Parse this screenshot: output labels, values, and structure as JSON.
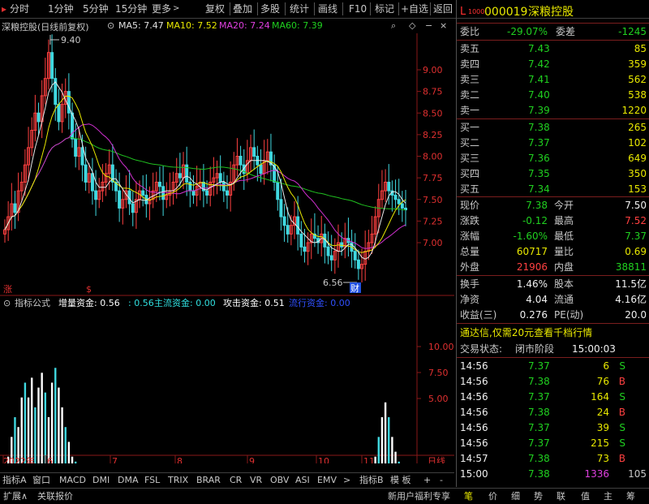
{
  "toolbar": {
    "items": [
      "分时",
      "1分钟",
      "5分钟",
      "15分钟",
      "更多",
      "复权",
      "叠加",
      "多股",
      "统计",
      "画线",
      "F10",
      "标记",
      "+自选",
      "返回"
    ]
  },
  "stock": {
    "code": "000019",
    "name": "深粮控股",
    "badge_main": "L",
    "badge_sub": "1000"
  },
  "main_chart": {
    "title": "深粮控股(日线前复权)",
    "ma": [
      {
        "label": "MA5: 7.47",
        "color": "#e0e0e0"
      },
      {
        "label": "MA10: 7.52",
        "color": "#e8e800"
      },
      {
        "label": "MA20: 7.24",
        "color": "#e040e0"
      },
      {
        "label": "MA60: 7.39",
        "color": "#20d020"
      }
    ],
    "y_labels": [
      "9.00",
      "8.75",
      "8.50",
      "8.25",
      "8.00",
      "7.75",
      "7.50",
      "7.25",
      "7.00"
    ],
    "high_label": "9.40",
    "low_label": "6.56",
    "marker_zhang": "涨",
    "marker_s": "$",
    "marker_cai": "财"
  },
  "sub_chart": {
    "title": "指标公式",
    "values": [
      {
        "label": "增量资金: 0.56",
        "color": "#ffffff"
      },
      {
        "label": ": 0.56",
        "color": "#30e0e0"
      },
      {
        "label": "主流资金: 0.00",
        "color": "#30e0e0"
      },
      {
        "label": "攻击资金: 0.51",
        "color": "#ffffff"
      },
      {
        "label": "流行资金: 0.00",
        "color": "#3050ff"
      }
    ],
    "y_labels": [
      "10.00",
      "7.50",
      "5.00"
    ]
  },
  "dates": [
    "2022年",
    "6",
    "7",
    "8",
    "9",
    "10",
    "11"
  ],
  "dates_right": "日线",
  "indicator_tabs": [
    "指标A",
    "窗口",
    "MACD",
    "DMI",
    "DMA",
    "FSL",
    "TRIX",
    "BRAR",
    "CR",
    "VR",
    "OBV",
    "ASI",
    "EMV",
    ">",
    "指标B",
    "模 板",
    "+",
    "-"
  ],
  "status_bar": {
    "left": [
      "扩展∧",
      "关联报价"
    ],
    "right_text": "新用户福利专享",
    "right_tabs": [
      "笔",
      "价",
      "细",
      "势",
      "联",
      "值",
      "主",
      "筹"
    ]
  },
  "quote": {
    "weibi_label": "委比",
    "weibi": "-29.07%",
    "weicha_label": "委差",
    "weicha": "-1245",
    "sell": [
      {
        "label": "卖五",
        "price": "7.43",
        "vol": "85"
      },
      {
        "label": "卖四",
        "price": "7.42",
        "vol": "359"
      },
      {
        "label": "卖三",
        "price": "7.41",
        "vol": "562"
      },
      {
        "label": "卖二",
        "price": "7.40",
        "vol": "538"
      },
      {
        "label": "卖一",
        "price": "7.39",
        "vol": "1220"
      }
    ],
    "buy": [
      {
        "label": "买一",
        "price": "7.38",
        "vol": "265"
      },
      {
        "label": "买二",
        "price": "7.37",
        "vol": "102"
      },
      {
        "label": "买三",
        "price": "7.36",
        "vol": "649"
      },
      {
        "label": "买四",
        "price": "7.35",
        "vol": "350"
      },
      {
        "label": "买五",
        "price": "7.34",
        "vol": "153"
      }
    ],
    "stats": [
      {
        "l1": "现价",
        "v1": "7.38",
        "c1": "grn",
        "l2": "今开",
        "v2": "7.50",
        "c2": "wht"
      },
      {
        "l1": "涨跌",
        "v1": "-0.12",
        "c1": "grn",
        "l2": "最高",
        "v2": "7.52",
        "c2": "red"
      },
      {
        "l1": "涨幅",
        "v1": "-1.60%",
        "c1": "grn",
        "l2": "最低",
        "v2": "7.37",
        "c2": "grn"
      },
      {
        "l1": "总量",
        "v1": "60717",
        "c1": "yel",
        "l2": "量比",
        "v2": "0.69",
        "c2": "yel"
      },
      {
        "l1": "外盘",
        "v1": "21906",
        "c1": "red",
        "l2": "内盘",
        "v2": "38811",
        "c2": "grn"
      }
    ],
    "stats2": [
      {
        "l1": "换手",
        "v1": "1.46%",
        "l2": "股本",
        "v2": "11.5亿"
      },
      {
        "l1": "净资",
        "v1": "4.04",
        "l2": "流通",
        "v2": "4.16亿"
      },
      {
        "l1": "收益(三)",
        "v1": "0.276",
        "l2": "PE(动)",
        "v2": "20.0"
      }
    ],
    "promo": "通达信,仅需20元查看千档行情",
    "trade_status_label": "交易状态:",
    "trade_status": "闭市阶段",
    "trade_time": "15:00:03",
    "ticks": [
      {
        "t": "14:56",
        "p": "7.37",
        "v": "6",
        "f": "S"
      },
      {
        "t": "14:56",
        "p": "7.38",
        "v": "76",
        "f": "B"
      },
      {
        "t": "14:56",
        "p": "7.37",
        "v": "164",
        "f": "S"
      },
      {
        "t": "14:56",
        "p": "7.38",
        "v": "24",
        "f": "B"
      },
      {
        "t": "14:56",
        "p": "7.37",
        "v": "39",
        "f": "S"
      },
      {
        "t": "14:56",
        "p": "7.37",
        "v": "215",
        "f": "S"
      },
      {
        "t": "14:57",
        "p": "7.38",
        "v": "73",
        "f": "B"
      },
      {
        "t": "15:00",
        "p": "7.38",
        "v": "1336",
        "f": "105"
      }
    ]
  }
}
